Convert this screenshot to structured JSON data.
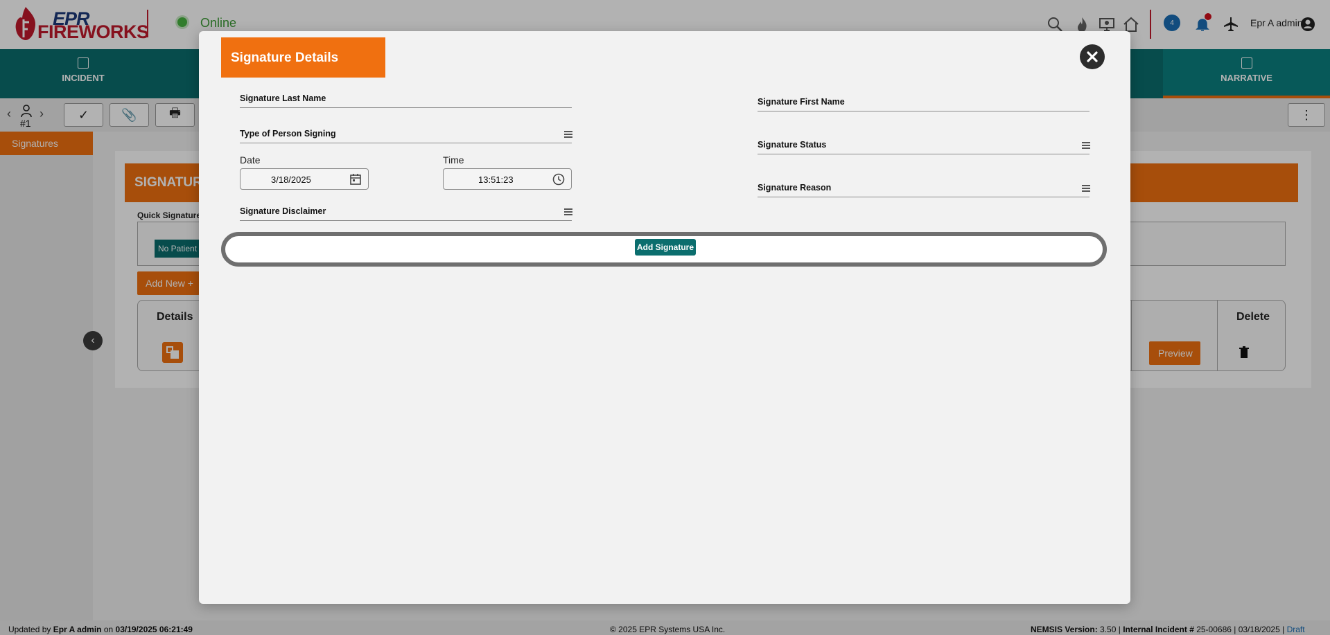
{
  "app": {
    "brand_top": "EPR",
    "brand_bottom": "FIREWORKS",
    "status": "Online",
    "chat_count": "4",
    "user_name": "Epr A admin"
  },
  "nav": {
    "incident": "INCIDENT",
    "narrative": "NARRATIVE"
  },
  "toolbar": {
    "patient_num": "#1"
  },
  "sidebar": {
    "items": [
      {
        "label": "Signatures"
      }
    ]
  },
  "signatures_page": {
    "header": "SIGNATURE",
    "quick_label": "Quick Signature",
    "no_patient": "No Patient",
    "add_new": "Add New +",
    "columns": {
      "details": "Details",
      "delete": "Delete"
    },
    "preview": "Preview"
  },
  "footer": {
    "updated_prefix": "Updated by ",
    "updated_user": "Epr A admin",
    "updated_on": " on ",
    "updated_time": "03/19/2025 06:21:49",
    "copyright": "© 2025 EPR Systems USA Inc.",
    "nemsis_label": "NEMSIS Version:",
    "nemsis_version": " 3.50 | ",
    "incident_label": "Internal Incident #",
    "incident_value": " 25-00686 | 03/18/2025 | ",
    "draft": "Draft"
  },
  "modal": {
    "title": "Signature Details",
    "fields": {
      "last_name": "Signature Last Name",
      "first_name": "Signature First Name",
      "person_signing": "Type of Person Signing",
      "status": "Signature Status",
      "reason": "Signature Reason",
      "disclaimer": "Signature Disclaimer",
      "date_label": "Date",
      "date_value": "3/18/2025",
      "time_label": "Time",
      "time_value": "13:51:23"
    },
    "add_signature": "Add Signature"
  },
  "colors": {
    "accent_orange": "#f07010",
    "teal": "#0b6e6e",
    "online_green": "#47b440"
  }
}
